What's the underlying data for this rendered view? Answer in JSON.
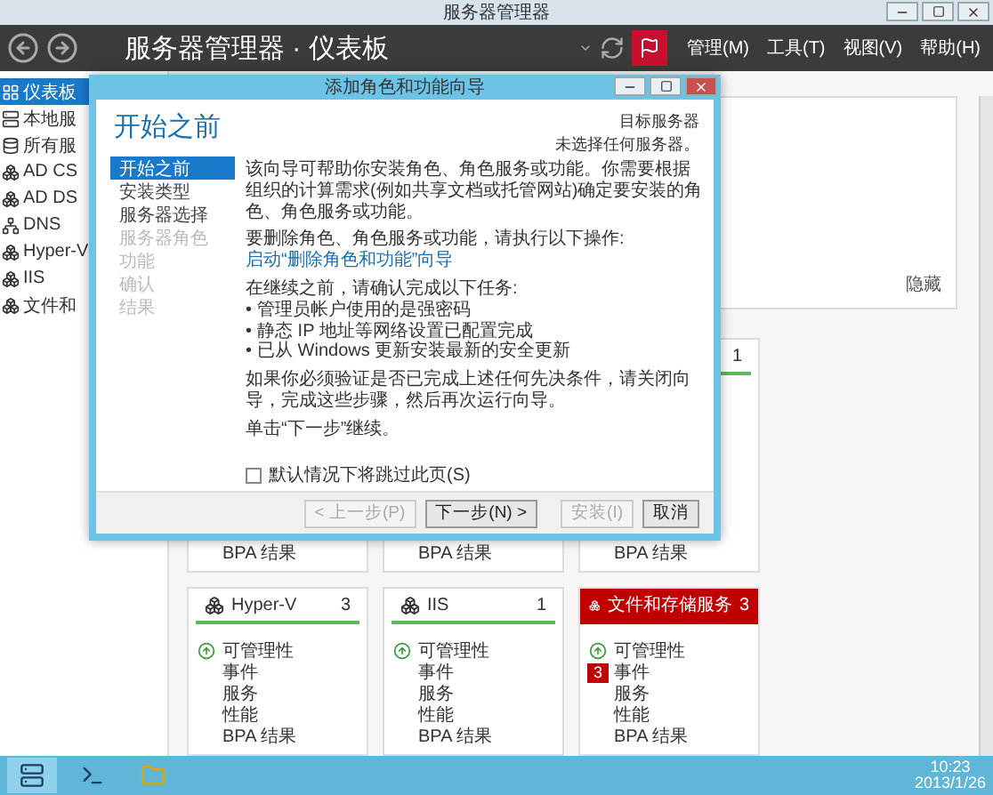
{
  "window": {
    "title": "服务器管理器"
  },
  "header": {
    "title": "服务器管理器 · 仪表板",
    "notification_alert": true,
    "menus": [
      "管理(M)",
      "工具(T)",
      "视图(V)",
      "帮助(H)"
    ]
  },
  "sidebar": {
    "items": [
      {
        "label": "仪表板",
        "selected": true
      },
      {
        "label": "本地服",
        "selected": false
      },
      {
        "label": "所有服",
        "selected": false
      },
      {
        "label": "AD CS",
        "selected": false
      },
      {
        "label": "AD DS",
        "selected": false
      },
      {
        "label": "DNS",
        "selected": false
      },
      {
        "label": "Hyper-V",
        "selected": false
      },
      {
        "label": "IIS",
        "selected": false
      },
      {
        "label": "文件和",
        "selected": false
      }
    ]
  },
  "welcome_panel": {
    "hide_link": "隐藏"
  },
  "role_tiles": [
    {
      "alert": false,
      "items": [
        {
          "label": "BPA 结果",
          "kind": "plain"
        }
      ]
    },
    {
      "alert": false,
      "items": [
        {
          "label": "BPA 结果",
          "kind": "plain"
        }
      ]
    },
    {
      "alert": false,
      "count": "1",
      "items": [
        {
          "label": "BPA 结果",
          "kind": "plain"
        }
      ]
    },
    {
      "title": "Hyper-V",
      "count": "3",
      "alert": false,
      "items": [
        {
          "label": "可管理性",
          "kind": "status"
        },
        {
          "label": "事件",
          "kind": "plain"
        },
        {
          "label": "服务",
          "kind": "plain"
        },
        {
          "label": "性能",
          "kind": "plain"
        },
        {
          "label": "BPA 结果",
          "kind": "plain"
        }
      ]
    },
    {
      "title": "IIS",
      "count": "1",
      "alert": false,
      "items": [
        {
          "label": "可管理性",
          "kind": "status"
        },
        {
          "label": "事件",
          "kind": "plain"
        },
        {
          "label": "服务",
          "kind": "plain"
        },
        {
          "label": "性能",
          "kind": "plain"
        },
        {
          "label": "BPA 结果",
          "kind": "plain"
        }
      ]
    },
    {
      "title": "文件和存储服务",
      "count": "3",
      "alert": true,
      "items": [
        {
          "label": "可管理性",
          "kind": "status"
        },
        {
          "label": "事件",
          "kind": "badge",
          "badge": "3"
        },
        {
          "label": "服务",
          "kind": "plain"
        },
        {
          "label": "性能",
          "kind": "plain"
        },
        {
          "label": "BPA 结果",
          "kind": "plain"
        }
      ]
    }
  ],
  "wizard": {
    "title": "添加角色和功能向导",
    "heading": "开始之前",
    "target_label": "目标服务器",
    "target_value": "未选择任何服务器。",
    "steps": [
      {
        "label": "开始之前",
        "selected": true,
        "disabled": false
      },
      {
        "label": "安装类型",
        "selected": false,
        "disabled": false
      },
      {
        "label": "服务器选择",
        "selected": false,
        "disabled": false
      },
      {
        "label": "服务器角色",
        "selected": false,
        "disabled": true
      },
      {
        "label": "功能",
        "selected": false,
        "disabled": true
      },
      {
        "label": "确认",
        "selected": false,
        "disabled": true
      },
      {
        "label": "结果",
        "selected": false,
        "disabled": true
      }
    ],
    "content": [
      {
        "kind": "text",
        "text": "该向导可帮助你安装角色、角色服务或功能。你需要根据组织的计算需求(例如共享文档或托管网站)确定要安装的角色、角色服务或功能。"
      },
      {
        "kind": "text",
        "text": "要删除角色、角色服务或功能，请执行以下操作:"
      },
      {
        "kind": "link",
        "text": "启动“删除角色和功能”向导"
      },
      {
        "kind": "text",
        "text": "在继续之前，请确认完成以下任务:"
      },
      {
        "kind": "bullet",
        "marker": "•",
        "text": "管理员帐户使用的是强密码"
      },
      {
        "kind": "bullet",
        "marker": "•",
        "text": "静态 IP 地址等网络设置已配置完成"
      },
      {
        "kind": "bullet",
        "marker": "•",
        "text": "已从 Windows 更新安装最新的安全更新"
      },
      {
        "kind": "text",
        "text": "如果你必须验证是否已完成上述任何先决条件，请关闭向导，完成这些步骤，然后再次运行向导。"
      },
      {
        "kind": "text",
        "text": "单击“下一步”继续。"
      }
    ],
    "skip_checkbox": {
      "label": "默认情况下将跳过此页(S)",
      "checked": false
    },
    "buttons": [
      {
        "label": "< 上一步(P)",
        "disabled": true
      },
      {
        "label": "下一步(N) >",
        "disabled": false
      },
      {
        "label": "安装(I)",
        "disabled": true
      },
      {
        "label": "取消",
        "disabled": false
      }
    ]
  },
  "taskbar": {
    "time": "10:23",
    "date": "2013/1/26"
  }
}
